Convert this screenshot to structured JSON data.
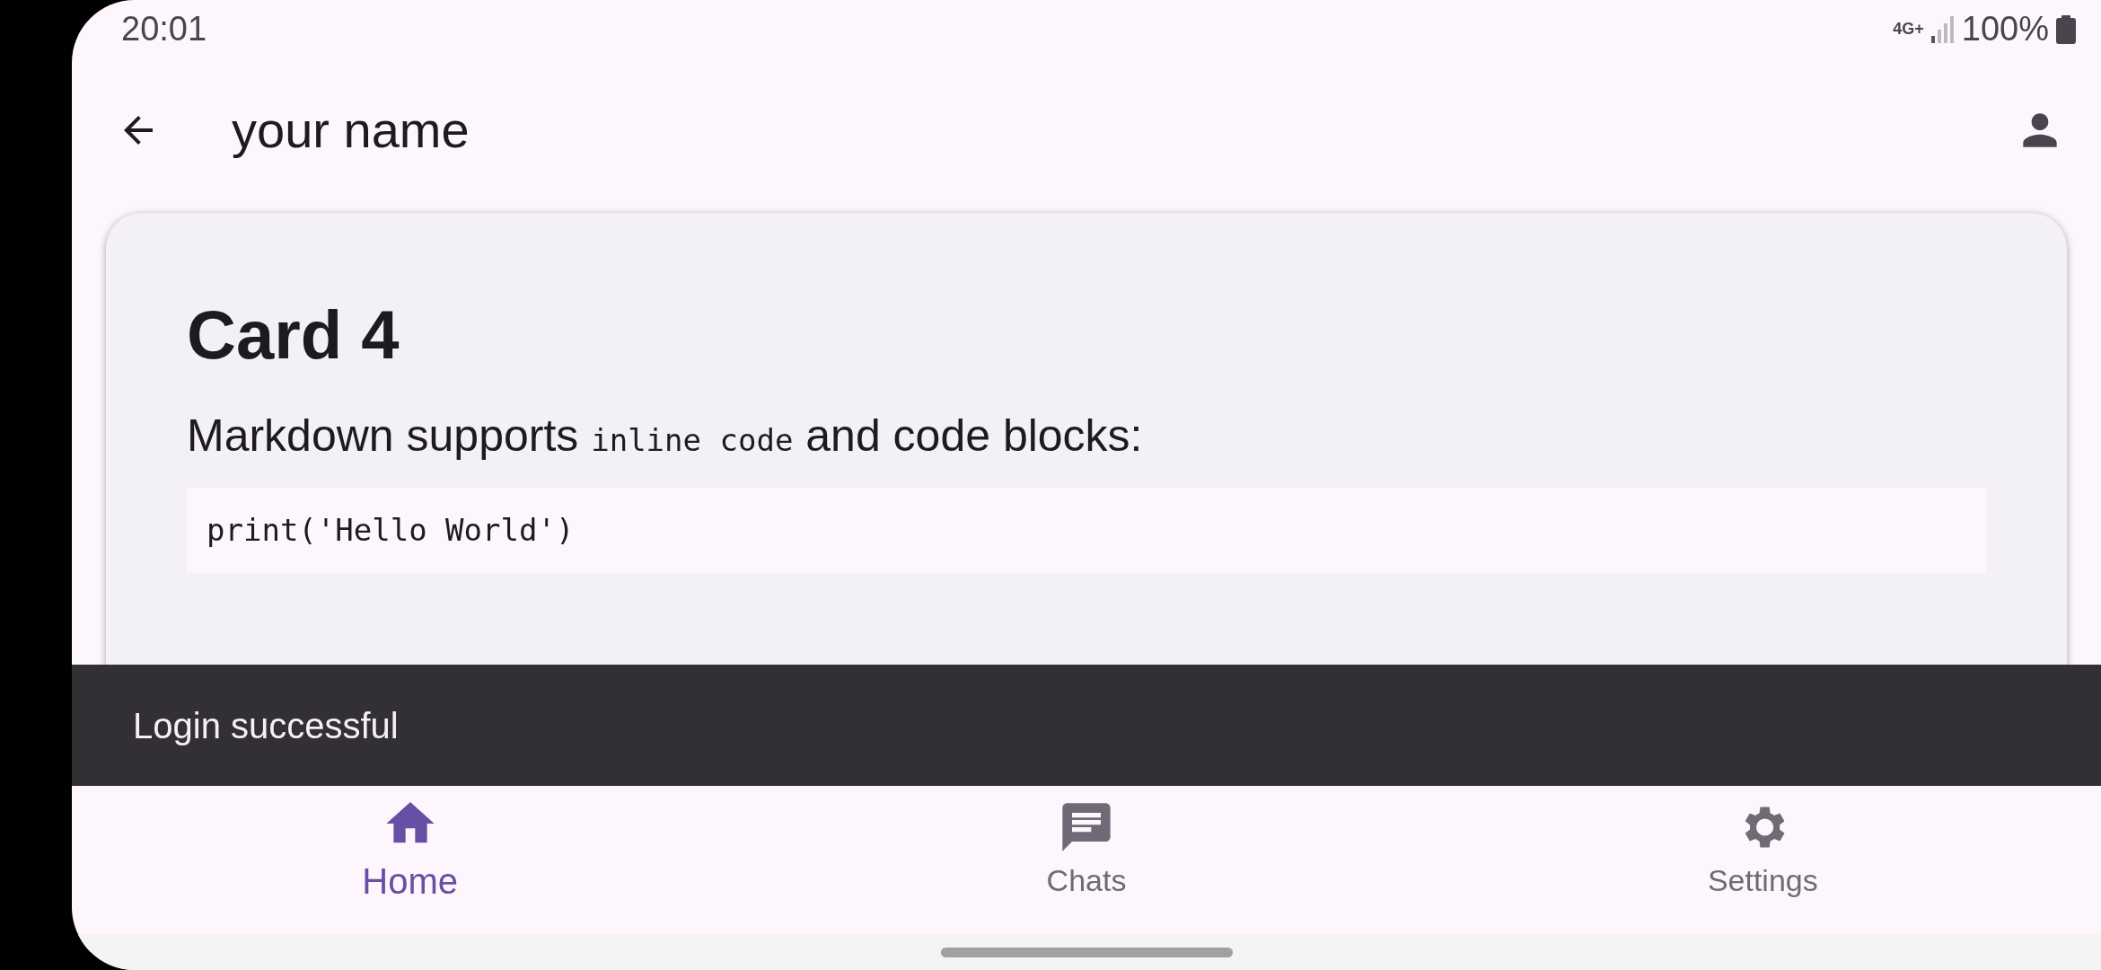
{
  "status_bar": {
    "time": "20:01",
    "network": "4G+",
    "battery": "100%"
  },
  "app_bar": {
    "title": "your name"
  },
  "card": {
    "title": "Card 4",
    "paragraph": [
      {
        "kind": "text",
        "text": "Markdown supports "
      },
      {
        "kind": "code",
        "text": "inline code"
      },
      {
        "kind": "text",
        "text": " and code blocks:"
      }
    ],
    "code_block": "print('Hello World')"
  },
  "snackbar": {
    "message": "Login successful"
  },
  "nav": [
    {
      "label": "Home",
      "kind": "home",
      "selected": true
    },
    {
      "label": "Chats",
      "kind": "chat",
      "selected": false
    },
    {
      "label": "Settings",
      "kind": "settings",
      "selected": false
    }
  ]
}
